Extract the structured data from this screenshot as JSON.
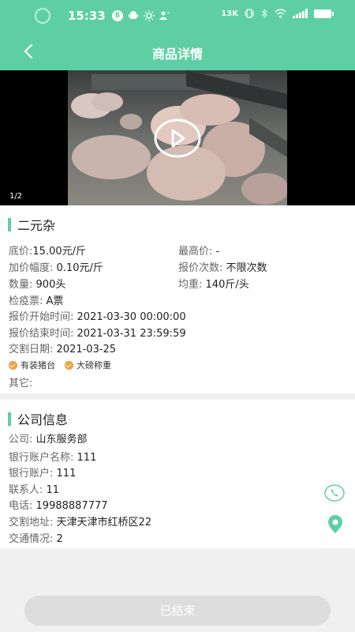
{
  "status_bar": {
    "time": "15:33",
    "badge": "8",
    "net_speed": "13K"
  },
  "header": {
    "title": "商品详情"
  },
  "media": {
    "page_indicator": "1/2"
  },
  "product": {
    "name": "二元杂",
    "rows": [
      {
        "label": "底价:",
        "value": "15.00元/斤"
      },
      {
        "label": "最高价:",
        "value": "-"
      },
      {
        "label": "加价幅度:",
        "value": "0.10元/斤"
      },
      {
        "label": "报价次数:",
        "value": "不限次数"
      },
      {
        "label": "数量:",
        "value": "900头"
      },
      {
        "label": "均重:",
        "value": "140斤/头"
      },
      {
        "label": "检疫票:",
        "value": "A票"
      },
      {
        "label": "报价开始时间:",
        "value": "2021-03-30 00:00:00"
      },
      {
        "label": "报价结束时间:",
        "value": "2021-03-31 23:59:59"
      },
      {
        "label": "交割日期:",
        "value": "2021-03-25"
      }
    ],
    "tags": [
      "有装猪台",
      "大磅称重"
    ],
    "other_label": "其它:",
    "other_value": ""
  },
  "company": {
    "title": "公司信息",
    "rows": [
      {
        "label": "公司:",
        "value": "山东服务部"
      },
      {
        "label": "银行账户名称:",
        "value": "111"
      },
      {
        "label": "银行账户:",
        "value": "111"
      },
      {
        "label": "联系人:",
        "value": "11"
      },
      {
        "label": "电话:",
        "value": "19988887777"
      },
      {
        "label": "交割地址:",
        "value": "天津天津市红桥区22"
      },
      {
        "label": "交通情况:",
        "value": "2"
      }
    ]
  },
  "action": {
    "status_label": "已结束"
  },
  "colors": {
    "accent": "#5ecfa5",
    "tag": "#f0a03c",
    "disabled": "#dddddd"
  }
}
